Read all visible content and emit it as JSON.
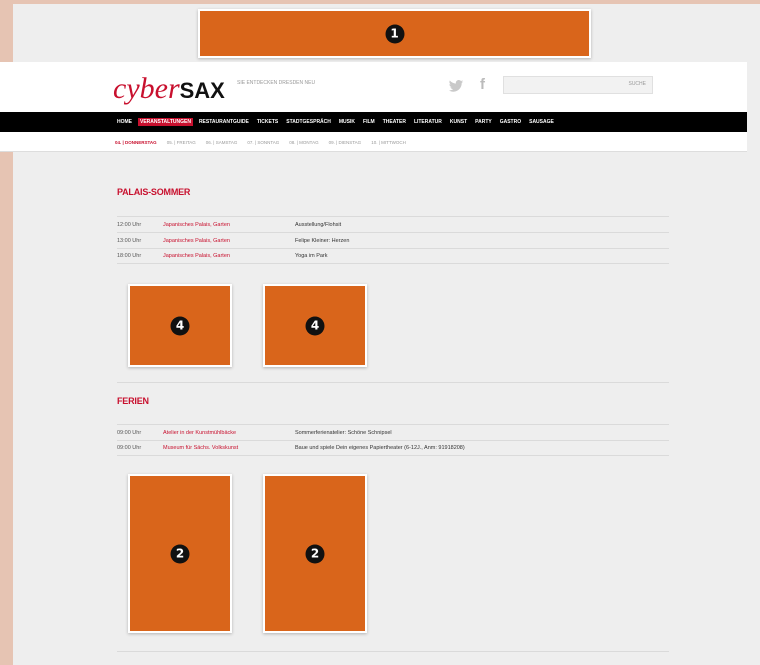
{
  "markers": {
    "top_banner": "1",
    "tall_ads": "2",
    "square_ads": "4"
  },
  "brand": {
    "logo_light": "cyber",
    "logo_bold": "SAX",
    "tagline": "Sie entdecken Dresden neu"
  },
  "search": {
    "button_label": "Suche"
  },
  "nav": {
    "items": [
      {
        "label": "Home",
        "active": false
      },
      {
        "label": "Veranstaltungen",
        "active": true
      },
      {
        "label": "Restaurantguide",
        "active": false
      },
      {
        "label": "Tickets",
        "active": false
      },
      {
        "label": "Stadtgespräch",
        "active": false
      },
      {
        "label": "Musik",
        "active": false
      },
      {
        "label": "Film",
        "active": false
      },
      {
        "label": "Theater",
        "active": false
      },
      {
        "label": "Literatur",
        "active": false
      },
      {
        "label": "Kunst",
        "active": false
      },
      {
        "label": "Party",
        "active": false
      },
      {
        "label": "Gastro",
        "active": false
      },
      {
        "label": "Sausage",
        "active": false
      }
    ]
  },
  "days": {
    "items": [
      {
        "label": "04. | Donnerstag",
        "active": true
      },
      {
        "label": "05. | Freitag",
        "active": false
      },
      {
        "label": "06. | Samstag",
        "active": false
      },
      {
        "label": "07. | Sonntag",
        "active": false
      },
      {
        "label": "08. | Montag",
        "active": false
      },
      {
        "label": "09. | Dienstag",
        "active": false
      },
      {
        "label": "10. | Mittwoch",
        "active": false
      }
    ]
  },
  "sections": [
    {
      "title": "Palais-Sommer",
      "events": [
        {
          "time": "12:00 Uhr",
          "place": "Japanisches Palais, Garten",
          "title": "Ausstellung/Flohsit"
        },
        {
          "time": "13:00 Uhr",
          "place": "Japanisches Palais, Garten",
          "title": "Felipe Kleiner: Herzen"
        },
        {
          "time": "18:00 Uhr",
          "place": "Japanisches Palais, Garten",
          "title": "Yoga im Park"
        }
      ]
    },
    {
      "title": "Ferien",
      "events": [
        {
          "time": "09:00 Uhr",
          "place": "Atelier in der Kunstmühlbäcke",
          "title": "Sommerferienatelier: Schöne Schnipsel"
        },
        {
          "time": "09:00 Uhr",
          "place": "Museum für Sächs. Volkskunst",
          "title": "Baue und spiele Dein eigenes Papiertheater (6-12J., Anm: 91918208)"
        }
      ]
    }
  ],
  "colors": {
    "accent": "#c8102e",
    "ad_fill": "#d9651b",
    "nav_bg": "#000000"
  }
}
